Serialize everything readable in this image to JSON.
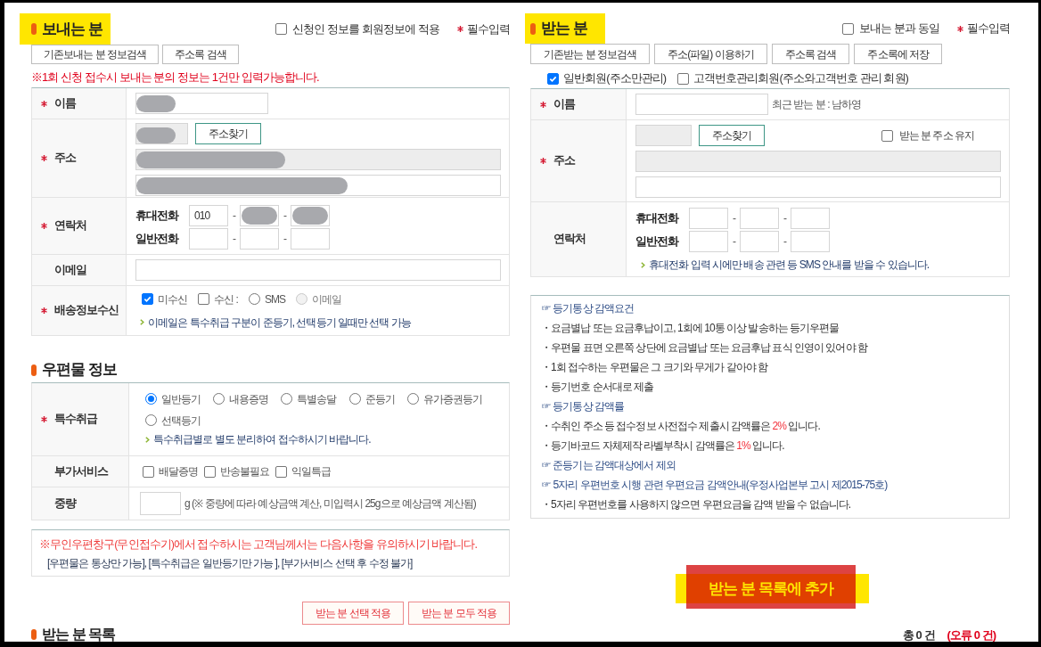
{
  "sender": {
    "title": {
      "text": "보내는 분",
      "highlighted": true
    },
    "apply_to_member": {
      "label": "신청인 정보를 회원정보에 적용",
      "checked": false
    },
    "required_legend": "필수입력",
    "buttons": [
      "기존보내는 분 정보검색",
      "주소록 검색"
    ],
    "warning": "※1회 신청 접수시 보내는 분의 정보는 1건만 입력가능합니다.",
    "rows": [
      {
        "kind": "name",
        "label": "이름",
        "required": true,
        "field": {
          "redacted": true
        }
      },
      {
        "kind": "address",
        "label": "주소",
        "required": true,
        "search_button": "주소찾기",
        "postcode": {
          "redacted": true
        },
        "line1": {
          "redacted": true
        },
        "line2": {
          "redacted": true
        }
      },
      {
        "kind": "contact",
        "label": "연락처",
        "required": true,
        "phones": [
          {
            "label": "휴대전화",
            "fields": [
              {
                "value": "010",
                "redacted": false
              },
              {
                "prefix": "-",
                "redacted": true
              },
              {
                "prefix": "-",
                "redacted": true
              }
            ]
          },
          {
            "label": "일반전화",
            "fields": [
              {
                "redacted": false
              },
              {
                "prefix": "-",
                "redacted": false
              },
              {
                "prefix": "-",
                "redacted": false
              }
            ]
          }
        ]
      },
      {
        "kind": "email",
        "label": "이메일",
        "required": false
      },
      {
        "kind": "delivery",
        "label": "배송정보수신",
        "required": true,
        "options": [
          {
            "kind": "checkbox",
            "label": "미수신",
            "checked": true
          },
          {
            "kind": "checkbox",
            "label": "수신 :",
            "checked": false
          },
          {
            "kind": "radio",
            "label": "SMS",
            "selected": false,
            "disabled": false
          },
          {
            "kind": "radio",
            "label": "이메일",
            "selected": false,
            "disabled": true
          }
        ],
        "note": "이메일은 특수취급 구분이 준등기, 선택등기 일때만 선택 가능"
      }
    ]
  },
  "mail_info": {
    "title": {
      "text": "우편물 정보",
      "highlighted": false
    },
    "special_handling": {
      "label": "특수취급",
      "required": true,
      "options": [
        {
          "label": "일반등기",
          "selected": true
        },
        {
          "label": "내용증명",
          "selected": false
        },
        {
          "label": "특별송달",
          "selected": false
        },
        {
          "label": "준등기",
          "selected": false
        },
        {
          "label": "유가증권등기",
          "selected": false
        },
        {
          "label": "선택등기",
          "selected": false
        }
      ],
      "note": "특수취급별로 별도 분리하여 접수하시기 바랍니다."
    },
    "extra_services": {
      "label": "부가서비스",
      "required": false,
      "options": [
        {
          "label": "배달증명",
          "checked": false
        },
        {
          "label": "반송불필요",
          "checked": false
        },
        {
          "label": "익일특급",
          "checked": false
        }
      ]
    },
    "weight": {
      "label": "중량",
      "required": false,
      "hint": "g (※ 중량에 따라 예상금액 계산, 미입력시 25g으로 예상금액 계산됨)"
    }
  },
  "kiosk_notice": {
    "warning": "※무인우편창구(무인접수기)에서 접수하시는 고객님께서는 다음사항을 유의하시기 바랍니다.",
    "rules": "[우편물은 통상만 가능], [특수취급은 일반등기만 가능 ], [부가서비스 선택 후 수정 불가]"
  },
  "apply_buttons": [
    "받는 분 선택 적용",
    "받는 분 모두 적용"
  ],
  "receiver": {
    "title": {
      "text": "받는 분",
      "highlighted": true
    },
    "same_as_sender": {
      "label": "보내는 분과 동일",
      "checked": false
    },
    "required_legend": "필수입력",
    "buttons": [
      "기존받는 분 정보검색",
      "주소(파일) 이용하기",
      "주소록 검색",
      "주소록에 저장"
    ],
    "member_types": [
      {
        "label": "일반회원(주소만관리)",
        "checked": true
      },
      {
        "label": "고객번호관리회원(주소와고객번호 관리 회원)",
        "checked": false
      }
    ],
    "rows": [
      {
        "kind": "name",
        "label": "이름",
        "required": true,
        "field": {
          "redacted": false
        },
        "recent": "최근 받는 분 : 남하영"
      },
      {
        "kind": "address",
        "label": "주소",
        "required": true,
        "search_button": "주소찾기",
        "keep": {
          "label": "받는 분 주소 유지",
          "checked": false
        },
        "postcode": {
          "redacted": false
        },
        "line1": {
          "redacted": false
        },
        "line2": {
          "redacted": false
        }
      },
      {
        "kind": "contact",
        "label": "연락처",
        "required": false,
        "phones": [
          {
            "label": "휴대전화",
            "fields": [
              {
                "redacted": false
              },
              {
                "prefix": "-",
                "redacted": false
              },
              {
                "prefix": "-",
                "redacted": false
              }
            ]
          },
          {
            "label": "일반전화",
            "fields": [
              {
                "redacted": false
              },
              {
                "prefix": "-",
                "redacted": false
              },
              {
                "prefix": "-",
                "redacted": false
              }
            ]
          }
        ],
        "note": "휴대전화 입력 시에만 배송 관련 등 SMS 안내를 받을 수 있습니다."
      }
    ],
    "info_box": [
      {
        "kind": "heading",
        "parts": [
          {
            "text": "☞ 등기통상 감액요건",
            "highlight": false
          }
        ]
      },
      {
        "kind": "bullet",
        "parts": [
          {
            "text": "・요금별납 또는 요금후납이고, 1회에 10통 이상 발송하는 등기우편물",
            "highlight": false
          }
        ]
      },
      {
        "kind": "bullet",
        "parts": [
          {
            "text": "・우편물 표면 오른쪽 상단에 요금별납 또는 요금후납 표식 인영이 있어야 함",
            "highlight": false
          }
        ]
      },
      {
        "kind": "bullet",
        "parts": [
          {
            "text": "・1회 접수하는 우편물은 그 크기와 무게가 같아야 함",
            "highlight": false
          }
        ]
      },
      {
        "kind": "bullet",
        "parts": [
          {
            "text": "・등기번호 순서대로 제출",
            "highlight": false
          }
        ]
      },
      {
        "kind": "heading",
        "parts": [
          {
            "text": "☞ 등기통상 감액률",
            "highlight": false
          }
        ]
      },
      {
        "kind": "bullet",
        "parts": [
          {
            "text": "・수취인 주소 등 접수정보 사전접수 제출시 감액률은 ",
            "highlight": false
          },
          {
            "text": "2%",
            "highlight": true
          },
          {
            "text": " 입니다.",
            "highlight": false
          }
        ]
      },
      {
        "kind": "bullet",
        "parts": [
          {
            "text": "・등기바코드 자체제작 라벨부착시 감액률은 ",
            "highlight": false
          },
          {
            "text": "1%",
            "highlight": true
          },
          {
            "text": " 입니다.",
            "highlight": false
          }
        ]
      },
      {
        "kind": "heading",
        "parts": [
          {
            "text": "☞ 준등기는 감액대상에서 제외",
            "highlight": false
          }
        ]
      },
      {
        "kind": "heading",
        "parts": [
          {
            "text": "☞ 5자리 우편번호 시행 관련 우편요금 감액안내(우정사업본부 고시 제2015-75호)",
            "highlight": false
          }
        ]
      },
      {
        "kind": "bullet",
        "parts": [
          {
            "text": "・5자리 우편번호를 사용하지 않으면 우편요금을 감액 받을 수 없습니다.",
            "highlight": false
          }
        ]
      }
    ],
    "add_button": {
      "label": "받는 분 목록에 추가",
      "highlighted": true
    }
  },
  "recipient_list": {
    "title": "받는 분 목록",
    "total": "총 0 건",
    "errors": "(오류 0 건)"
  }
}
